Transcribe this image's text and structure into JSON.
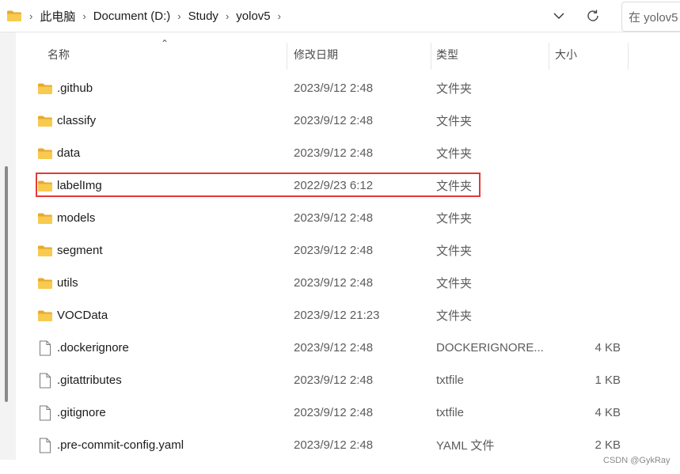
{
  "address_bar": {
    "breadcrumbs": [
      "此电脑",
      "Document (D:)",
      "Study",
      "yolov5"
    ],
    "search_placeholder": "在 yolov5"
  },
  "columns": {
    "name": "名称",
    "date": "修改日期",
    "type": "类型",
    "size": "大小"
  },
  "files": [
    {
      "icon": "folder-icon",
      "name": ".github",
      "date": "2023/9/12 2:48",
      "type": "文件夹",
      "size": ""
    },
    {
      "icon": "folder-icon",
      "name": "classify",
      "date": "2023/9/12 2:48",
      "type": "文件夹",
      "size": ""
    },
    {
      "icon": "folder-icon",
      "name": "data",
      "date": "2023/9/12 2:48",
      "type": "文件夹",
      "size": ""
    },
    {
      "icon": "folder-icon",
      "name": "labelImg",
      "date": "2022/9/23 6:12",
      "type": "文件夹",
      "size": ""
    },
    {
      "icon": "folder-icon",
      "name": "models",
      "date": "2023/9/12 2:48",
      "type": "文件夹",
      "size": ""
    },
    {
      "icon": "folder-icon",
      "name": "segment",
      "date": "2023/9/12 2:48",
      "type": "文件夹",
      "size": ""
    },
    {
      "icon": "folder-icon",
      "name": "utils",
      "date": "2023/9/12 2:48",
      "type": "文件夹",
      "size": ""
    },
    {
      "icon": "folder-icon",
      "name": "VOCData",
      "date": "2023/9/12 21:23",
      "type": "文件夹",
      "size": ""
    },
    {
      "icon": "file-icon",
      "name": ".dockerignore",
      "date": "2023/9/12 2:48",
      "type": "DOCKERIGNORE...",
      "size": "4 KB"
    },
    {
      "icon": "file-icon",
      "name": ".gitattributes",
      "date": "2023/9/12 2:48",
      "type": "txtfile",
      "size": "1 KB"
    },
    {
      "icon": "file-icon",
      "name": ".gitignore",
      "date": "2023/9/12 2:48",
      "type": "txtfile",
      "size": "4 KB"
    },
    {
      "icon": "file-icon",
      "name": ".pre-commit-config.yaml",
      "date": "2023/9/12 2:48",
      "type": "YAML 文件",
      "size": "2 KB"
    }
  ],
  "highlighted_item": "labelImg",
  "highlight_color": "#e53935",
  "folder_color": "#f6c343",
  "watermark": "CSDN @GykRay"
}
